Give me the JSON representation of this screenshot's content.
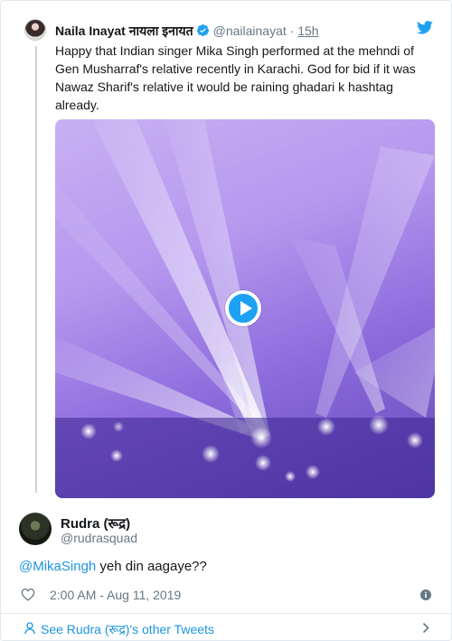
{
  "quoted_tweet": {
    "author_name": "Naila Inayat नायला इनायत",
    "handle": "@nailainayat",
    "separator": " · ",
    "time": "15h",
    "text": "Happy that Indian singer Mika Singh performed at the mehndi of Gen Musharraf's relative recently in Karachi. God for bid if it was Nawaz Sharif's relative it would be raining ghadari k hashtag already."
  },
  "tweet": {
    "author_name": "Rudra (रूद्र)",
    "handle": "@rudrasquad",
    "mention": "@MikaSingh",
    "reply_text": " yeh din aagaye??",
    "timestamp": "2:00 AM - Aug 11, 2019"
  },
  "footer": {
    "see_more_label": "See Rudra (रूद्र)'s other Tweets"
  },
  "icons": {
    "verified": "verified-badge-icon",
    "bird": "twitter-bird-icon",
    "play": "play-icon",
    "heart": "heart-icon",
    "info": "info-icon",
    "person": "person-icon",
    "chevron": "chevron-right-icon"
  },
  "colors": {
    "accent": "#1da1f2",
    "link": "#1b95e0",
    "text": "#14171a",
    "muted": "#657786",
    "border": "#e1e8ed"
  }
}
